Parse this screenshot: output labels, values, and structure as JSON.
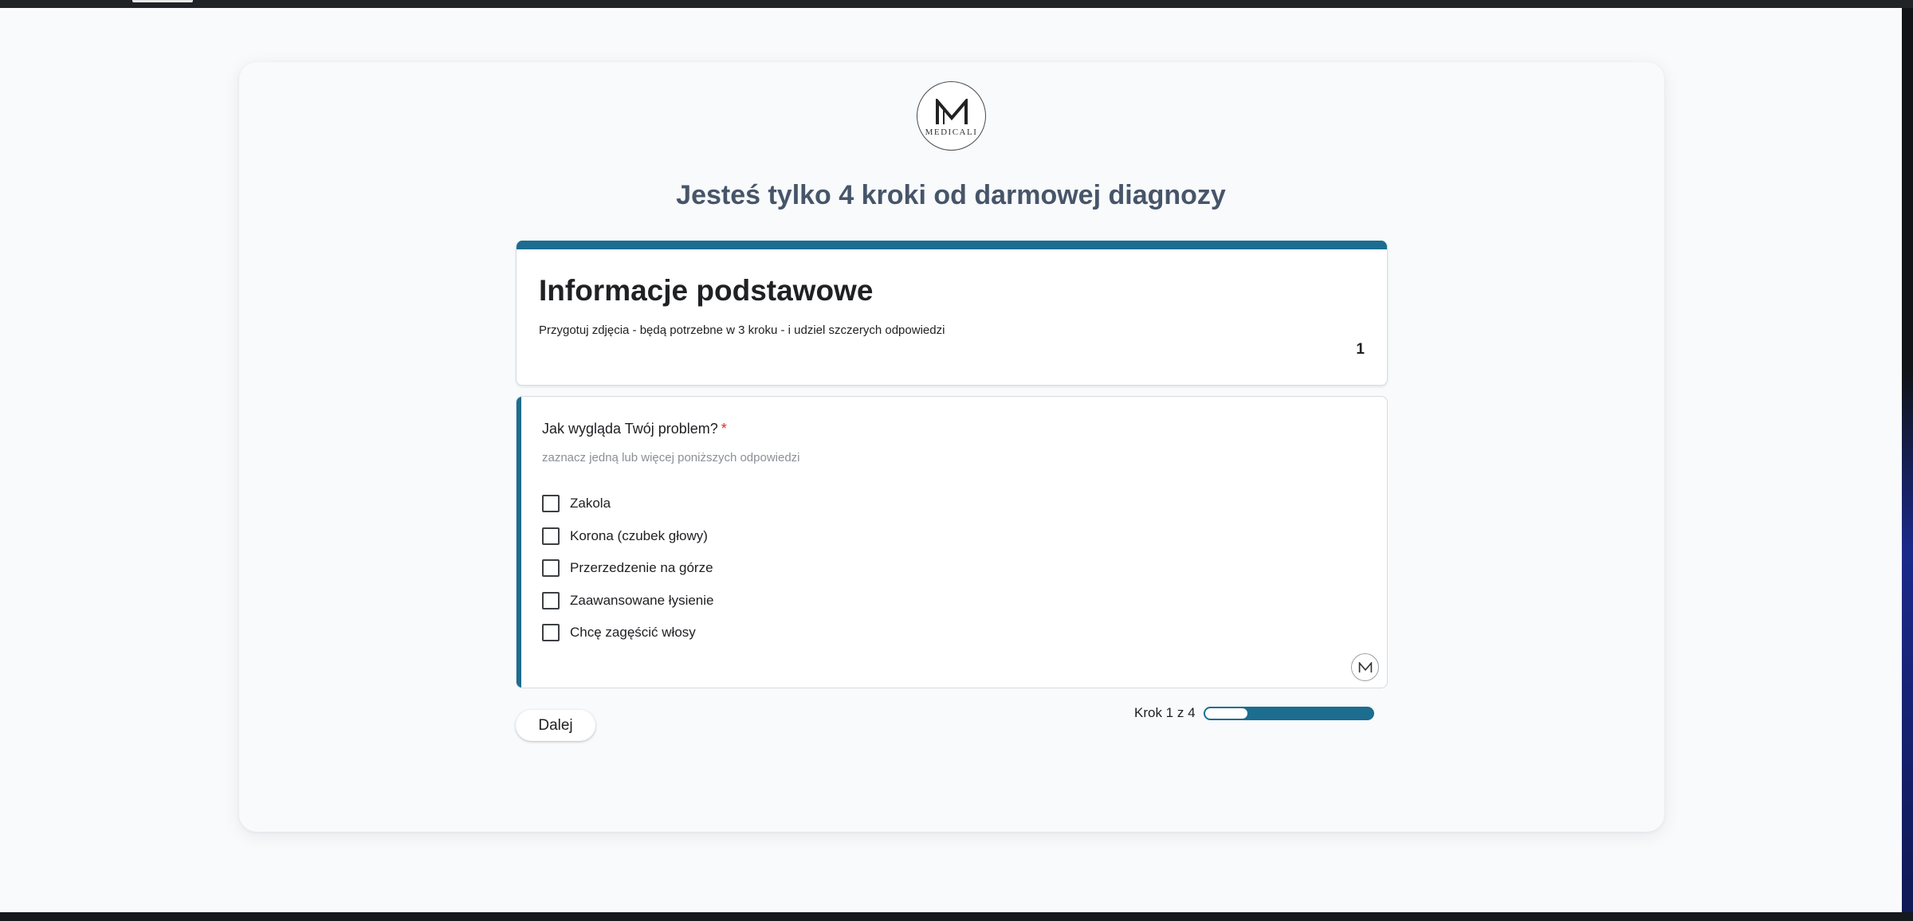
{
  "brand": {
    "logo_text": "MEDICALI",
    "accent_color": "#1c6d8f",
    "heading_color": "#475569"
  },
  "headline": "Jesteś tylko 4 kroki od darmowej diagnozy",
  "info": {
    "title": "Informacje podstawowe",
    "description": "Przygotuj zdjęcia - będą potrzebne w 3 kroku - i udziel szczerych odpowiedzi",
    "section_number": "1"
  },
  "question": {
    "label": "Jak wygląda Twój problem?",
    "required_mark": "*",
    "hint": "zaznacz jedną lub więcej poniższych odpowiedzi",
    "options": [
      {
        "label": "Zakola",
        "checked": false
      },
      {
        "label": "Korona (czubek głowy)",
        "checked": false
      },
      {
        "label": "Przerzedzenie na górze",
        "checked": false
      },
      {
        "label": "Zaawansowane łysienie",
        "checked": false
      },
      {
        "label": "Chcę zagęścić włosy",
        "checked": false
      }
    ]
  },
  "footer": {
    "next_label": "Dalej",
    "step_text": "Krok 1 z 4",
    "progress_fraction": 0.25
  }
}
